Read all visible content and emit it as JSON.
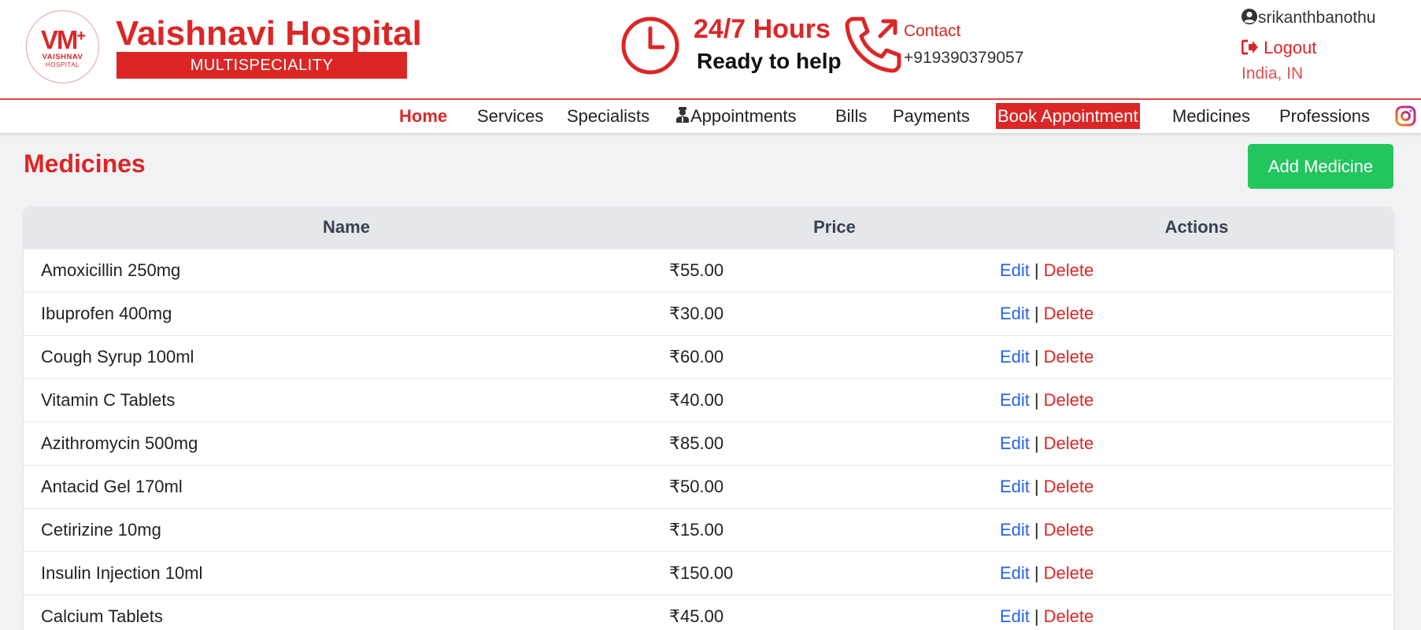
{
  "colors": {
    "brand_red": "#dc2626",
    "add_green": "#22c55e",
    "edit_blue": "#2563eb",
    "table_header_bg": "#e5e7eb",
    "page_bg": "#f1f2f4"
  },
  "header": {
    "logo": {
      "mark": "VM",
      "plus": "+",
      "line1": "VAISHNAV",
      "line2": "HOSPITAL"
    },
    "brand_name": "Vaishnavi Hospital",
    "brand_sub": "MULTISPECIALITY",
    "hours": "24/7 Hours",
    "ready": "Ready to help",
    "contact_label": "Contact",
    "phone": "+919390379057",
    "username": "srikanthbanothu",
    "logout": "Logout",
    "locale": "India, IN",
    "icons": [
      "clock-icon",
      "phone-icon",
      "user-circle-icon",
      "logout-icon",
      "instagram-icon"
    ]
  },
  "nav": {
    "items": [
      {
        "label": "Home",
        "active": true
      },
      {
        "label": "Services"
      },
      {
        "label": "Specialists"
      },
      {
        "label": "Appointments",
        "icon": "doctor-icon"
      },
      {
        "label": "Bills"
      },
      {
        "label": "Payments"
      },
      {
        "label": "Book Appointment",
        "highlight": true
      },
      {
        "label": "Medicines"
      },
      {
        "label": "Professions"
      }
    ]
  },
  "main": {
    "title": "Medicines",
    "add_button": "Add Medicine",
    "table": {
      "columns": [
        "Name",
        "Price",
        "Actions"
      ],
      "edit_label": "Edit",
      "separator": "|",
      "delete_label": "Delete",
      "rows": [
        {
          "name": "Amoxicillin 250mg",
          "price": "₹55.00"
        },
        {
          "name": "Ibuprofen 400mg",
          "price": "₹30.00"
        },
        {
          "name": "Cough Syrup 100ml",
          "price": "₹60.00"
        },
        {
          "name": "Vitamin C Tablets",
          "price": "₹40.00"
        },
        {
          "name": "Azithromycin 500mg",
          "price": "₹85.00"
        },
        {
          "name": "Antacid Gel 170ml",
          "price": "₹50.00"
        },
        {
          "name": "Cetirizine 10mg",
          "price": "₹15.00"
        },
        {
          "name": "Insulin Injection 10ml",
          "price": "₹150.00"
        },
        {
          "name": "Calcium Tablets",
          "price": "₹45.00"
        }
      ]
    }
  }
}
